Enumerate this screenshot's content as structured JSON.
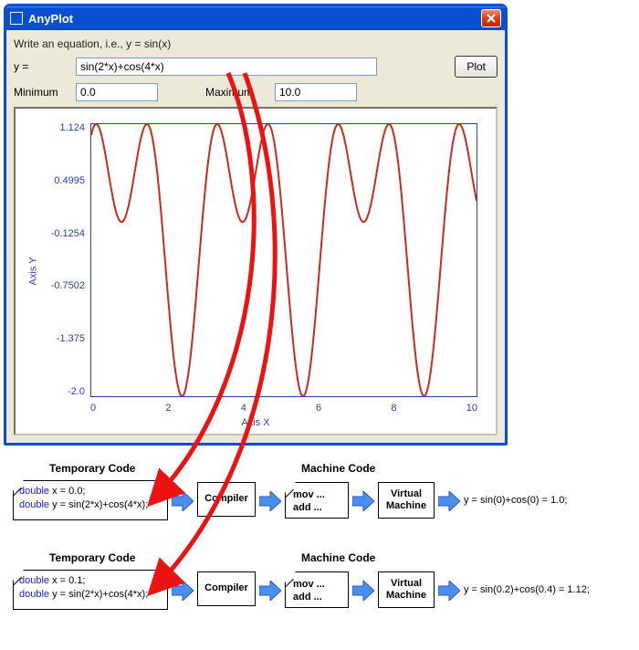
{
  "window": {
    "title": "AnyPlot",
    "instruction": "Write an equation, i.e., y = sin(x)",
    "y_label": "y =",
    "equation_value": "sin(2*x)+cos(4*x)",
    "plot_button": "Plot",
    "min_label": "Minimum",
    "min_value": "0.0",
    "max_label": "Maximum",
    "max_value": "10.0"
  },
  "chart_data": {
    "type": "line",
    "title": "",
    "xlabel": "Axis X",
    "ylabel": "Axis Y",
    "xlim": [
      0,
      10
    ],
    "ylim": [
      -2.0,
      1.124
    ],
    "xticks": [
      "0",
      "2",
      "4",
      "6",
      "8",
      "10"
    ],
    "yticks": [
      "1.124",
      "0.4995",
      "-0.1254",
      "-0.7502",
      "-1.375",
      "-2.0"
    ],
    "series_formula": "sin(2*x)+cos(4*x)",
    "series_color": "#cc2a1c"
  },
  "diagram": {
    "tempcode_header": "Temporary Code",
    "machinecode_header": "Machine Code",
    "compiler_label": "Compiler",
    "machine_content": "mov ...\nadd ...",
    "vm_label": "Virtual\nMachine",
    "rows": [
      {
        "code_line1_kw": "double",
        "code_line1_rest": " x = 0.0;",
        "code_line2_kw": "double",
        "code_line2_rest": " y = sin(2*x)+cos(4*x);",
        "result": "y = sin(0)+cos(0) = 1.0;"
      },
      {
        "code_line1_kw": "double",
        "code_line1_rest": " x = 0.1;",
        "code_line2_kw": "double",
        "code_line2_rest": " y = sin(2*x)+cos(4*x);",
        "result": "y = sin(0.2)+cos(0.4) = 1.12;"
      }
    ]
  }
}
